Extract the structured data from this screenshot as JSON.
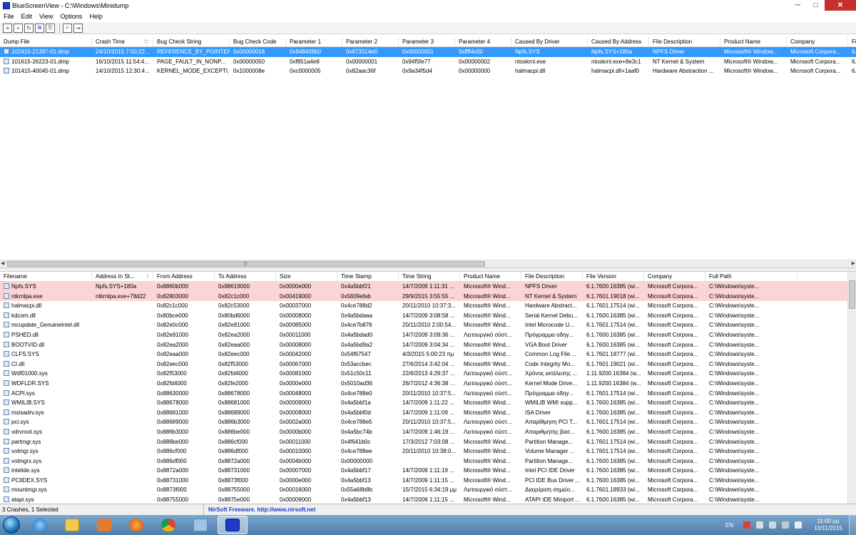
{
  "window": {
    "title": "BlueScreenView  -  C:\\Windows\\Minidump",
    "minimize": "─",
    "maximize": "□",
    "close": "✕"
  },
  "menu": [
    "File",
    "Edit",
    "View",
    "Options",
    "Help"
  ],
  "crash_list": {
    "columns": [
      "Dump File",
      "Crash Time",
      "Bug Check String",
      "Bug Check Code",
      "Parameter 1",
      "Parameter 2",
      "Parameter 3",
      "Parameter 4",
      "Caused By Driver",
      "Caused By Address",
      "File Description",
      "Product Name",
      "Company",
      "Fi"
    ],
    "sort_indicator": "▽",
    "rows": [
      [
        "102415-21387-01.dmp",
        "24/10/2015 7:50:22...",
        "REFERENCE_BY_POINTER",
        "0x00000018",
        "0x848408b0",
        "0x873314e0",
        "0x00000001",
        "0xffff4c00",
        "Npfs.SYS",
        "Npfs.SYS+180a",
        "NPFS Driver",
        "Microsoft® Window...",
        "Microsoft Corpora...",
        "6.1"
      ],
      [
        "101615-26223-01.dmp",
        "16/10/2015 11:54:4...",
        "PAGE_FAULT_IN_NONP...",
        "0x00000050",
        "0xf851a4e8",
        "0x00000001",
        "0x94f5fe77",
        "0x00000002",
        "ntoskrnl.exe",
        "ntoskrnl.exe+8e3c1",
        "NT Kernel & System",
        "Microsoft® Window...",
        "Microsoft Corpora...",
        "6.1"
      ],
      [
        "101415-40045-01.dmp",
        "14/10/2015 12:30:4...",
        "KERNEL_MODE_EXCEPTI...",
        "0x1000008e",
        "0xc0000005",
        "0x82aac36f",
        "0x9a34f5d4",
        "0x00000000",
        "halmacpi.dll",
        "halmacpi.dll+1aaf0",
        "Hardware Abstraction ...",
        "Microsoft® Window...",
        "Microsoft Corpora...",
        "6.1"
      ]
    ]
  },
  "driver_list": {
    "columns": [
      "Filename",
      "Address In St...",
      "From Address",
      "To Address",
      "Size",
      "Time Stamp",
      "Time String",
      "Product Name",
      "File Description",
      "File Version",
      "Company",
      "Full Path"
    ],
    "sort_indicator": "/",
    "rows": [
      [
        "Npfs.SYS",
        "Npfs.SYS+180a",
        "0x8860b000",
        "0x88619000",
        "0x0000e000",
        "0x4a5bbf21",
        "14/7/2009 1:11:31 ...",
        "Microsoft® Wind...",
        "NPFS Driver",
        "6.1.7600.16385 (wi...",
        "Microsoft Corpora...",
        "C:\\Windows\\syste..."
      ],
      [
        "ntkrnlpa.exe",
        "ntkrnlpa.exe+78d22",
        "0x82803000",
        "0x82c1c000",
        "0x00419000",
        "0x5609efab",
        "29/9/2015 3:55:55 ...",
        "Microsoft® Wind...",
        "NT Kernel & System",
        "6.1.7601.19018 (wi...",
        "Microsoft Corpora...",
        "C:\\Windows\\syste..."
      ],
      [
        "halmacpi.dll",
        "",
        "0x82c1c000",
        "0x82c53000",
        "0x00037000",
        "0x4ce788d2",
        "20/11/2010 10:37:3...",
        "Microsoft® Wind...",
        "Hardware Abstract...",
        "6.1.7601.17514 (wi...",
        "Microsoft Corpora...",
        "C:\\Windows\\syste..."
      ],
      [
        "kdcom.dll",
        "",
        "0x80bce000",
        "0x80bd6000",
        "0x00008000",
        "0x4a5bdaaa",
        "14/7/2009 3:08:58 ...",
        "Microsoft® Wind...",
        "Serial Kernel Debu...",
        "6.1.7600.16385 (wi...",
        "Microsoft Corpora...",
        "C:\\Windows\\syste..."
      ],
      [
        "mcupdate_GenuineIntel.dll",
        "",
        "0x82e0c000",
        "0x82e91000",
        "0x00085000",
        "0x4ce7b876",
        "20/11/2010 2:00:54...",
        "Microsoft® Wind...",
        "Intel Microcode U...",
        "6.1.7601.17514 (wi...",
        "Microsoft Corpora...",
        "C:\\Windows\\syste..."
      ],
      [
        "PSHED.dll",
        "",
        "0x82e91000",
        "0x82ea2000",
        "0x00011000",
        "0x4a5bdad0",
        "14/7/2009 3:09:36 ...",
        "Λειτουργικό σύστ...",
        "Πρόγραμμα οδηγ...",
        "6.1.7600.16385 (wi...",
        "Microsoft Corpora...",
        "C:\\Windows\\syste..."
      ],
      [
        "BOOTVID.dll",
        "",
        "0x82ea2000",
        "0x82eaa000",
        "0x00008000",
        "0x4a5bd9a2",
        "14/7/2009 3:04:34 ...",
        "Microsoft® Wind...",
        "VGA Boot Driver",
        "6.1.7600.16385 (wi...",
        "Microsoft Corpora...",
        "C:\\Windows\\syste..."
      ],
      [
        "CLFS.SYS",
        "",
        "0x82eaa000",
        "0x82eec000",
        "0x00042000",
        "0x54f67547",
        "4/3/2015 5:00:23 πμ",
        "Microsoft® Wind...",
        "Common Log File ...",
        "6.1.7601.18777 (wi...",
        "Microsoft Corpora...",
        "C:\\Windows\\syste..."
      ],
      [
        "CI.dll",
        "",
        "0x82eec000",
        "0x82f53000",
        "0x00067000",
        "0x53accbec",
        "27/6/2014 3:42:04 ...",
        "Microsoft® Wind...",
        "Code Integrity Mo...",
        "6.1.7601.19021 (wi...",
        "Microsoft Corpora...",
        "C:\\Windows\\syste..."
      ],
      [
        "Wdf01000.sys",
        "",
        "0x82f53000",
        "0x82fd4000",
        "0x00081000",
        "0x51c50c11",
        "22/6/2013 4:29:37 ...",
        "Λειτουργικό σύστ...",
        "Χρόνος εκτέλεσης ...",
        "1.11.9200.16384 (w...",
        "Microsoft Corpora...",
        "C:\\Windows\\syste..."
      ],
      [
        "WDFLDR.SYS",
        "",
        "0x82fd4000",
        "0x82fe2000",
        "0x0000e000",
        "0x5010ad36",
        "26/7/2012 4:36:38 ...",
        "Λειτουργικό σύστ...",
        "Kernel Mode Drive...",
        "1.11.9200.16384 (w...",
        "Microsoft Corpora...",
        "C:\\Windows\\syste..."
      ],
      [
        "ACPI.sys",
        "",
        "0x88630000",
        "0x88678000",
        "0x00048000",
        "0x4ce788e0",
        "20/11/2010 10:37:5...",
        "Λειτουργικό σύστ...",
        "Πρόγραμμα οδηγ...",
        "6.1.7601.17514 (wi...",
        "Microsoft Corpora...",
        "C:\\Windows\\syste..."
      ],
      [
        "WMILIB.SYS",
        "",
        "0x88678000",
        "0x88681000",
        "0x00009000",
        "0x4a5bbf1a",
        "14/7/2009 1:11:22 ...",
        "Microsoft® Wind...",
        "WMILIB WMI supp...",
        "6.1.7600.16385 (wi...",
        "Microsoft Corpora...",
        "C:\\Windows\\syste..."
      ],
      [
        "msisadrv.sys",
        "",
        "0x88681000",
        "0x88689000",
        "0x00008000",
        "0x4a5bbf0d",
        "14/7/2009 1:11:09 ...",
        "Microsoft® Wind...",
        "ISA Driver",
        "6.1.7600.16385 (wi...",
        "Microsoft Corpora...",
        "C:\\Windows\\syste..."
      ],
      [
        "pci.sys",
        "",
        "0x88689000",
        "0x886b3000",
        "0x0002a000",
        "0x4ce788e5",
        "20/11/2010 10:37:5...",
        "Λειτουργικό σύστ...",
        "Απαρίθμηση PCI T...",
        "6.1.7601.17514 (wi...",
        "Microsoft Corpora...",
        "C:\\Windows\\syste..."
      ],
      [
        "vdrvroot.sys",
        "",
        "0x886b3000",
        "0x886be000",
        "0x0000b000",
        "0x4a5bc74b",
        "14/7/2009 1:46:19 ...",
        "Λειτουργικό σύστ...",
        "Απαριθμητής βασ...",
        "6.1.7600.16385 (wi...",
        "Microsoft Corpora...",
        "C:\\Windows\\syste..."
      ],
      [
        "partmgr.sys",
        "",
        "0x886be000",
        "0x886cf000",
        "0x00011000",
        "0x4f641b0c",
        "17/3/2012 7:03:08 ...",
        "Microsoft® Wind...",
        "Partition Manage...",
        "6.1.7601.17514 (wi...",
        "Microsoft Corpora...",
        "C:\\Windows\\syste..."
      ],
      [
        "volmgr.sys",
        "",
        "0x886cf000",
        "0x886df000",
        "0x00010000",
        "0x4ce788ee",
        "20/11/2010 10:38:0...",
        "Microsoft® Wind...",
        "Volume Manager ...",
        "6.1.7601.17514 (wi...",
        "Microsoft Corpora...",
        "C:\\Windows\\syste..."
      ],
      [
        "volmgrx.sys",
        "",
        "0x886df000",
        "0x8872a000",
        "0x0004b000",
        "0x00000000",
        "",
        "Microsoft® Wind...",
        "Partition Manage...",
        "6.1.7600.16385 (wi...",
        "Microsoft Corpora...",
        "C:\\Windows\\syste..."
      ],
      [
        "intelide.sys",
        "",
        "0x8872a000",
        "0x88731000",
        "0x00007000",
        "0x4a5bbf17",
        "14/7/2009 1:11:19 ...",
        "Microsoft® Wind...",
        "Intel PCI IDE Driver",
        "6.1.7600.16385 (wi...",
        "Microsoft Corpora...",
        "C:\\Windows\\syste..."
      ],
      [
        "PCIIDEX.SYS",
        "",
        "0x88731000",
        "0x8873f000",
        "0x0000e000",
        "0x4a5bbf13",
        "14/7/2009 1:11:15 ...",
        "Microsoft® Wind...",
        "PCI IDE Bus Driver ...",
        "6.1.7600.16385 (wi...",
        "Microsoft Corpora...",
        "C:\\Windows\\syste..."
      ],
      [
        "mountmgr.sys",
        "",
        "0x8873f000",
        "0x88755000",
        "0x00016000",
        "0x55a68b8b",
        "15/7/2015 6:34:19 μμ",
        "Λειτουργικό σύστ...",
        "Διαχείριση σημείο...",
        "6.1.7601.18933 (wi...",
        "Microsoft Corpora...",
        "C:\\Windows\\syste..."
      ],
      [
        "atapi.sys",
        "",
        "0x88755000",
        "0x8875e000",
        "0x00009000",
        "0x4a5bbf13",
        "14/7/2009 1:11:15 ...",
        "Microsoft® Wind...",
        "ATAPI IDE Miniport ...",
        "6.1.7600.16385 (wi...",
        "Microsoft Corpora...",
        "C:\\Windows\\syste..."
      ]
    ]
  },
  "status": {
    "count": "3 Crashes, 1 Selected",
    "link": "NirSoft Freeware.  http://www.nirsoft.net"
  },
  "taskbar": {
    "apps": [
      "internet-explorer",
      "file-explorer",
      "media-player",
      "firefox",
      "chrome",
      "window-manager",
      "bluescreenview"
    ],
    "lang": "EN",
    "clock_time": "11:00 μμ",
    "clock_date": "10/11/2015"
  },
  "colors": {
    "selection": "#3399ff",
    "highlight_row": "#fad4d6",
    "taskbar": "#5e8fbb",
    "link": "#1c3bc8"
  }
}
